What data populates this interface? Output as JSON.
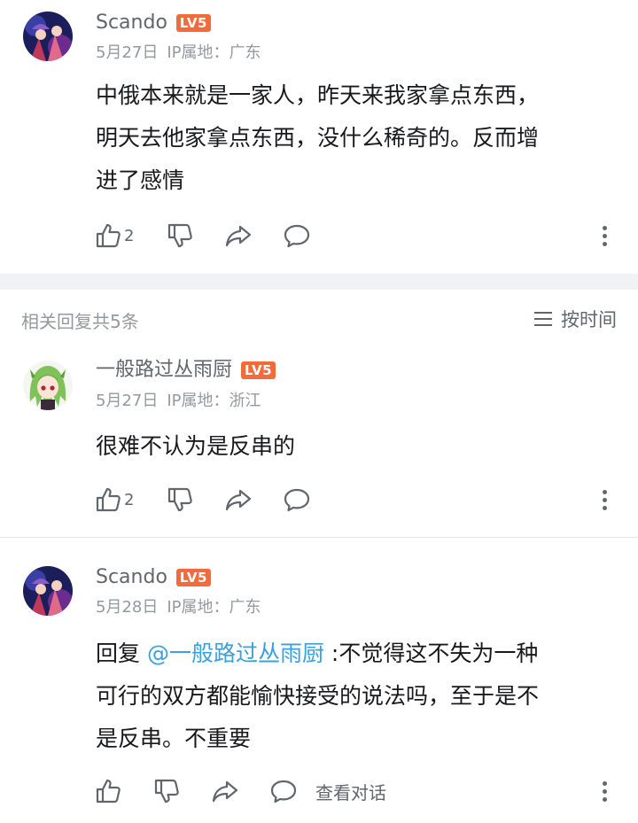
{
  "main_comment": {
    "username": "Scando",
    "level": "LV5",
    "date": "5月27日",
    "ip": "IP属地：广东",
    "text_lines": [
      "中俄本来就是一家人，昨天来我家拿点东西，",
      "明天去他家拿点东西，没什么稀奇的。反而增",
      "进了感情"
    ],
    "like_count": "2"
  },
  "replies_header": {
    "count_label": "相关回复共5条",
    "sort_label": "按时间"
  },
  "reply1": {
    "username": "一般路过丛雨厨",
    "level": "LV5",
    "date": "5月27日",
    "ip": "IP属地：浙江",
    "text": "很难不认为是反串的",
    "like_count": "2"
  },
  "reply2": {
    "username": "Scando",
    "level": "LV5",
    "date": "5月28日",
    "ip": "IP属地：广东",
    "prefix": "回复 ",
    "mention": "@一般路过丛雨厨",
    "line1_rest": " :不觉得这不失为一种",
    "line2": "可行的双方都能愉快接受的说法吗，至于是不",
    "line3": "是反串。不重要",
    "view_conversation": "查看对话"
  },
  "colors": {
    "level_badge": "#f26b3a",
    "mention": "#3aa0e0",
    "separator_band": "#f1f2f3"
  },
  "icons": [
    "thumb-up-icon",
    "thumb-down-icon",
    "share-icon",
    "comment-icon",
    "more-vertical-icon",
    "sort-lines-icon"
  ]
}
